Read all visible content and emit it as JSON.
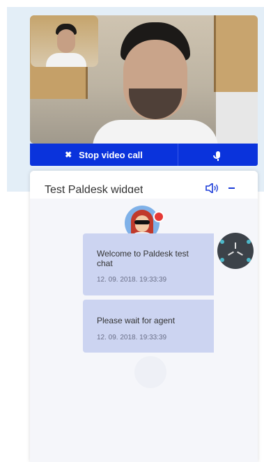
{
  "video_call": {
    "stop_label": "Stop video call",
    "stop_icon": "close-icon",
    "mic_icon": "microphone-icon"
  },
  "widget": {
    "title": "Test Paldesk widget",
    "speaker_icon": "speaker-icon",
    "minimize_icon": "minimize-icon"
  },
  "messages": [
    {
      "text": "Welcome to Paldesk test chat",
      "time": "12. 09. 2018. 19:33:39"
    },
    {
      "text": "Please wait for agent",
      "time": "12. 09. 2018. 19:33:39"
    }
  ],
  "colors": {
    "accent": "#0a33dc",
    "bubble": "#ccd4f1",
    "status": "#e53935",
    "loader": "#3c4249"
  }
}
